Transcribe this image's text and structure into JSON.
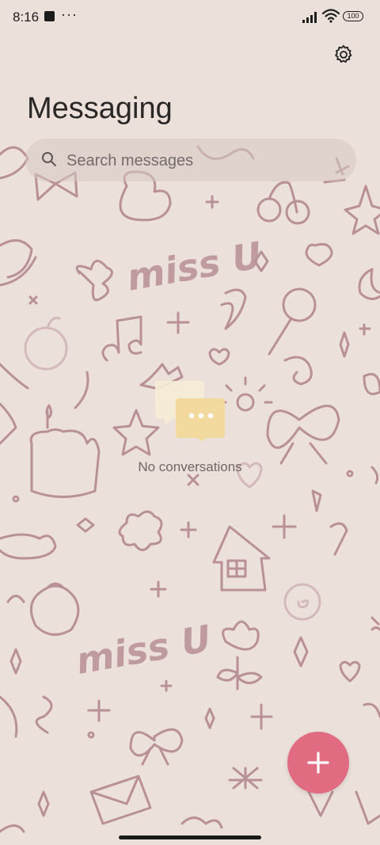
{
  "status_bar": {
    "time": "8:16",
    "overflow_dots": "···",
    "battery_level": "100"
  },
  "header": {
    "title": "Messaging",
    "settings_icon": "gear-icon"
  },
  "search": {
    "placeholder": "Search messages",
    "icon": "search-icon"
  },
  "empty_state": {
    "icon": "chat-bubbles-icon",
    "text": "No conversations"
  },
  "fab": {
    "icon": "plus-icon",
    "color": "#e16b81"
  },
  "wallpaper": {
    "doodle_text_1": "miss U",
    "doodle_text_2": "miss U"
  },
  "colors": {
    "background": "#ece0da",
    "doodle": "#b89096",
    "accent": "#e16b81"
  }
}
